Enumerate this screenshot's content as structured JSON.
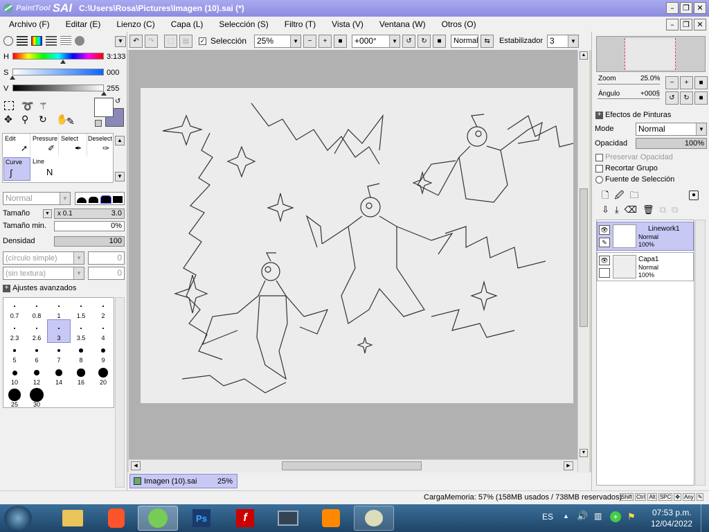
{
  "app": {
    "logo_small": "PaintTool",
    "logo_big": "SAI",
    "title": "C:\\Users\\Rosa\\Pictures\\Imagen (10).sai (*)"
  },
  "menu": [
    "Archivo (F)",
    "Editar (E)",
    "Lienzo (C)",
    "Capa (L)",
    "Selección (S)",
    "Filtro (T)",
    "Vista (V)",
    "Ventana (W)",
    "Otros (O)"
  ],
  "color": {
    "h_label": "H",
    "h_value": "3:133",
    "s_label": "S",
    "s_value": "000",
    "v_label": "V",
    "v_value": "255",
    "h_level": 0.55,
    "s_level": 0.0,
    "v_level": 1.0,
    "secondary": "#8a88b8"
  },
  "tools": {
    "slots": [
      "Edit",
      "Pressure",
      "Select",
      "Deselect",
      "Curve",
      "Line"
    ]
  },
  "brush": {
    "mode": "Normal",
    "size_label": "Tamaño",
    "size_mult": "x 0.1",
    "size_value": "3.0",
    "min_label": "Tamaño min.",
    "min_value": "0%",
    "density_label": "Densidad",
    "density_value": "100",
    "shape": "(círculo simple)",
    "shape_value": "0",
    "texture": "(sin textura)",
    "texture_value": "0",
    "advanced": "Ajustes avanzados",
    "sizes": [
      "0.7",
      "0.8",
      "1",
      "1.5",
      "2",
      "2.3",
      "2.6",
      "3",
      "3.5",
      "4",
      "5",
      "6",
      "7",
      "8",
      "9",
      "10",
      "12",
      "14",
      "16",
      "20",
      "25",
      "30"
    ],
    "selected_size": "3"
  },
  "toolbar": {
    "selection_label": "Selección",
    "zoom": "25%",
    "angle": "+000°",
    "blend": "Normal",
    "stabilizer_label": "Estabilizador",
    "stabilizer": "3"
  },
  "navigator": {
    "zoom_label": "Zoom",
    "zoom_value": "25.0%",
    "angle_label": "Ángulo",
    "angle_value": "+000§"
  },
  "layers_panel": {
    "effects": "Efectos de Pinturas",
    "mode_label": "Mode",
    "mode_value": "Normal",
    "opacity_label": "Opacidad",
    "opacity_value": "100%",
    "preserve": "Preservar Opacidad",
    "clip": "Recortar Grupo",
    "source": "Fuente de Selección",
    "layers": [
      {
        "name": "Linework1",
        "mode": "Normal",
        "opacity": "100%"
      },
      {
        "name": "Capa1",
        "mode": "Normal",
        "opacity": "100%"
      }
    ]
  },
  "tab": {
    "name": "Imagen (10).sai",
    "zoom": "25%"
  },
  "status": {
    "memory": "CargaMemoria: 57% (158MB usados / 738MB reservados)",
    "keys": [
      "Shift",
      "Ctrl",
      "Alt",
      "SPC",
      "Any"
    ]
  },
  "taskbar": {
    "lang": "ES",
    "time": "07:53 p.m.",
    "date": "12/04/2022"
  }
}
